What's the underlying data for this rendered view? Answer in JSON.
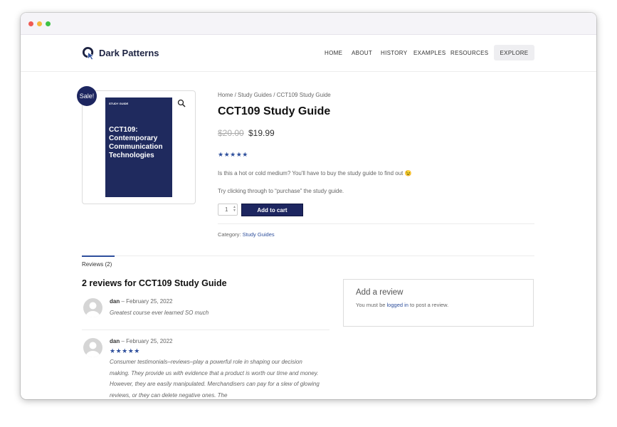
{
  "brand": {
    "name": "Dark Patterns"
  },
  "nav": {
    "items": [
      "HOME",
      "ABOUT",
      "HISTORY",
      "EXAMPLES",
      "RESOURCES"
    ],
    "explore_label": "EXPLORE"
  },
  "product": {
    "sale_badge": "Sale!",
    "cover_label": "STUDY GUIDE",
    "cover_title": "CCT109: Contemporary Communication Technologies",
    "breadcrumb": {
      "home": "Home",
      "sep1": " / ",
      "section": "Study Guides",
      "sep2": " / ",
      "current": "CCT109 Study Guide"
    },
    "title": "CCT109 Study Guide",
    "old_price": "$20.00",
    "new_price": "$19.99",
    "rating": 5,
    "description1": "Is this a hot or cold medium? You'll have to buy the study guide to find out 😉",
    "description2": "Try clicking through to “purchase” the study guide.",
    "quantity": "1",
    "add_to_cart": "Add to cart",
    "category_label": "Category: ",
    "category_value": "Study Guides"
  },
  "tabs": {
    "reviews_tab": "Reviews (2)"
  },
  "reviews": {
    "heading": "2 reviews for CCT109 Study Guide",
    "items": [
      {
        "author": "dan",
        "date": " – February 25, 2022",
        "text": "Greatest course ever learned SO much"
      },
      {
        "author": "dan",
        "date": " – February 25, 2022",
        "rating": 5,
        "text": "Consumer testimonials–reviews–play a powerful role in shaping our decision making. They provide us with evidence that a product is worth our time and money. However, they are easily manipulated. Merchandisers can pay for a slew of glowing reviews, or they can delete negative ones. The"
      }
    ]
  },
  "add_review": {
    "title": "Add a review",
    "text_before": "You must be ",
    "link": "logged in",
    "text_after": " to post a review."
  },
  "colors": {
    "brand_navy": "#1d2660",
    "link_blue": "#2e4f9c"
  },
  "icons": [
    "logo-cursor-icon",
    "magnifier-icon",
    "avatar-placeholder-icon",
    "star-icon"
  ]
}
